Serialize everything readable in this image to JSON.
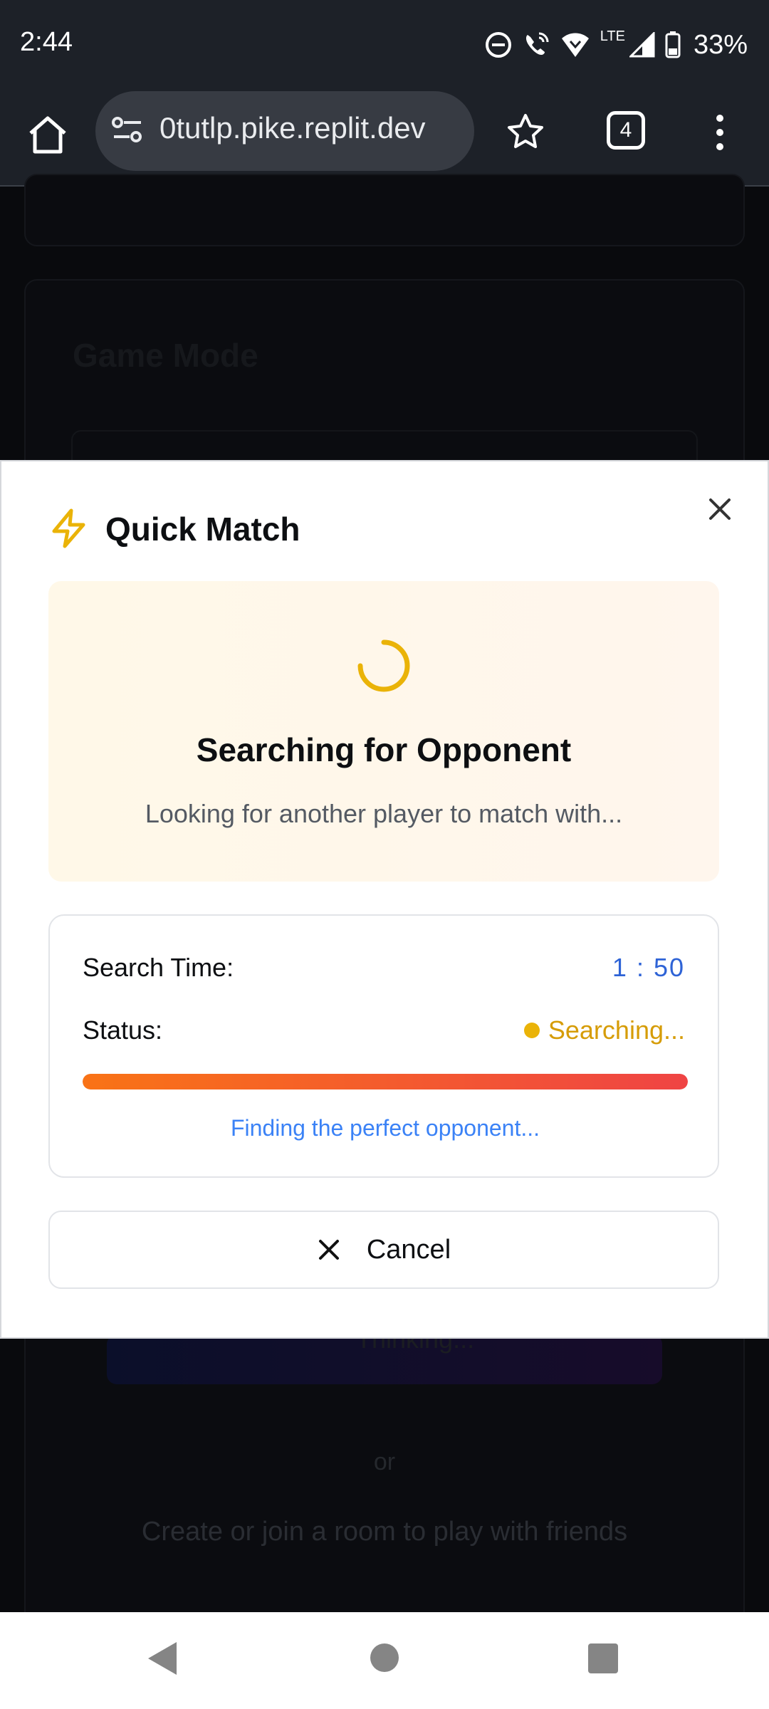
{
  "status_bar": {
    "time": "2:44",
    "network": "LTE",
    "battery": "33%"
  },
  "browser": {
    "url": "0tutlp.pike.replit.dev",
    "tab_count": "4"
  },
  "background_page": {
    "section_heading": "Game Mode",
    "thinking_label": "Thinking...",
    "divider": "or",
    "room_hint": "Create or join a room to play with friends"
  },
  "modal": {
    "title": "Quick Match",
    "search": {
      "heading": "Searching for Opponent",
      "subtext": "Looking for another player to match with..."
    },
    "info": {
      "time_label": "Search Time:",
      "time_value": "1 : 50",
      "status_label": "Status:",
      "status_value": "Searching...",
      "progress_fraction": 1.0,
      "finding_text": "Finding the perfect opponent..."
    },
    "cancel_label": "Cancel"
  },
  "colors": {
    "accent_yellow": "#eab308",
    "time_blue": "#2e63d6",
    "progress_start": "#f97316",
    "progress_end": "#ef4444"
  }
}
